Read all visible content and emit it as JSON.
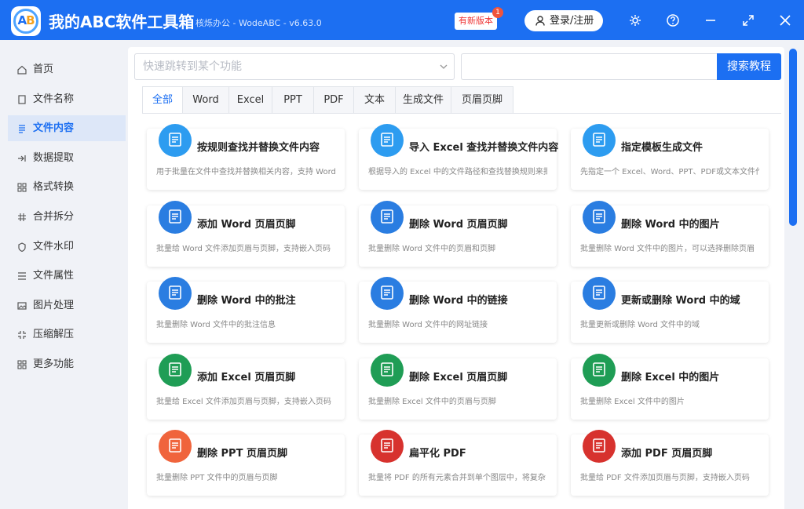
{
  "app": {
    "title": "我的ABC软件工具箱",
    "subtitle": "核烁办公 - WodeABC - v6.63.0",
    "logo_text_a": "A",
    "logo_text_b": "B",
    "new_version_label": "有新版本",
    "new_version_badge": "1",
    "login_label": "登录/注册",
    "icons": [
      "settings-icon",
      "help-icon",
      "minimize-icon",
      "maximize-icon",
      "close-icon"
    ]
  },
  "colors": {
    "brand": "#1c6ff2",
    "active_bg": "#dde7f8"
  },
  "sidebar": {
    "items": [
      {
        "label": "首页",
        "icon": "home-icon",
        "active": false
      },
      {
        "label": "文件名称",
        "icon": "file-name-icon",
        "active": false
      },
      {
        "label": "文件内容",
        "icon": "file-content-icon",
        "active": true
      },
      {
        "label": "数据提取",
        "icon": "data-extract-icon",
        "active": false
      },
      {
        "label": "格式转换",
        "icon": "format-convert-icon",
        "active": false
      },
      {
        "label": "合并拆分",
        "icon": "merge-split-icon",
        "active": false
      },
      {
        "label": "文件水印",
        "icon": "watermark-icon",
        "active": false
      },
      {
        "label": "文件属性",
        "icon": "file-props-icon",
        "active": false
      },
      {
        "label": "图片处理",
        "icon": "image-icon",
        "active": false
      },
      {
        "label": "压缩解压",
        "icon": "compress-icon",
        "active": false
      },
      {
        "label": "更多功能",
        "icon": "more-icon",
        "active": false
      }
    ]
  },
  "search": {
    "placeholder": "快速跳转到某个功能",
    "tutorial_button": "搜索教程"
  },
  "tabs": [
    {
      "label": "全部",
      "active": true
    },
    {
      "label": "Word",
      "active": false
    },
    {
      "label": "Excel",
      "active": false
    },
    {
      "label": "PPT",
      "active": false
    },
    {
      "label": "PDF",
      "active": false
    },
    {
      "label": "文本",
      "active": false
    },
    {
      "label": "生成文件",
      "active": false
    },
    {
      "label": "页眉页脚",
      "active": false
    }
  ],
  "cards": [
    {
      "title": "按规则查找并替换文件内容",
      "desc": "用于批量在文件中查找并替换相关内容，支持 Word",
      "icon": "find-replace-icon",
      "color": "#2d9cf0"
    },
    {
      "title": "导入 Excel 查找并替换文件内容",
      "desc": "根据导入的 Excel 中的文件路径和查找替换规则来批",
      "icon": "excel-replace-icon",
      "color": "#2d9cf0"
    },
    {
      "title": "指定模板生成文件",
      "desc": "先指定一个 Excel、Word、PPT、PDF或文本文件作",
      "icon": "template-icon",
      "color": "#2d9cf0"
    },
    {
      "title": "添加 Word 页眉页脚",
      "desc": "批量给 Word 文件添加页眉与页脚，支持嵌入页码",
      "icon": "word-header-add-icon",
      "color": "#2a7de1"
    },
    {
      "title": "删除 Word 页眉页脚",
      "desc": "批量删除 Word 文件中的页眉和页脚",
      "icon": "word-header-delete-icon",
      "color": "#2a7de1"
    },
    {
      "title": "删除 Word 中的图片",
      "desc": "批量删除 Word 文件中的图片，可以选择删除页眉",
      "icon": "word-image-delete-icon",
      "color": "#2a7de1"
    },
    {
      "title": "删除 Word 中的批注",
      "desc": "批量删除 Word 文件中的批注信息",
      "icon": "word-comment-delete-icon",
      "color": "#2a7de1"
    },
    {
      "title": "删除 Word 中的链接",
      "desc": "批量删除 Word 文件中的网址链接",
      "icon": "word-link-delete-icon",
      "color": "#2a7de1"
    },
    {
      "title": "更新或删除 Word 中的域",
      "desc": "批量更新或删除 Word 文件中的域",
      "icon": "word-field-icon",
      "color": "#2a7de1"
    },
    {
      "title": "添加 Excel 页眉页脚",
      "desc": "批量给 Excel 文件添加页眉与页脚，支持嵌入页码",
      "icon": "excel-header-add-icon",
      "color": "#1f9d55"
    },
    {
      "title": "删除 Excel 页眉页脚",
      "desc": "批量删除 Excel 文件中的页眉与页脚",
      "icon": "excel-header-delete-icon",
      "color": "#1f9d55"
    },
    {
      "title": "删除 Excel 中的图片",
      "desc": "批量删除 Excel 文件中的图片",
      "icon": "excel-image-delete-icon",
      "color": "#1f9d55"
    },
    {
      "title": "删除 PPT 页眉页脚",
      "desc": "批量删除 PPT 文件中的页眉与页脚",
      "icon": "ppt-header-delete-icon",
      "color": "#f0643c"
    },
    {
      "title": "扁平化 PDF",
      "desc": "批量将 PDF 的所有元素合并到单个图层中，将复杂",
      "icon": "pdf-flatten-icon",
      "color": "#d7322e"
    },
    {
      "title": "添加 PDF 页眉页脚",
      "desc": "批量给 PDF 文件添加页眉与页脚，支持嵌入页码",
      "icon": "pdf-header-add-icon",
      "color": "#d7322e"
    }
  ]
}
